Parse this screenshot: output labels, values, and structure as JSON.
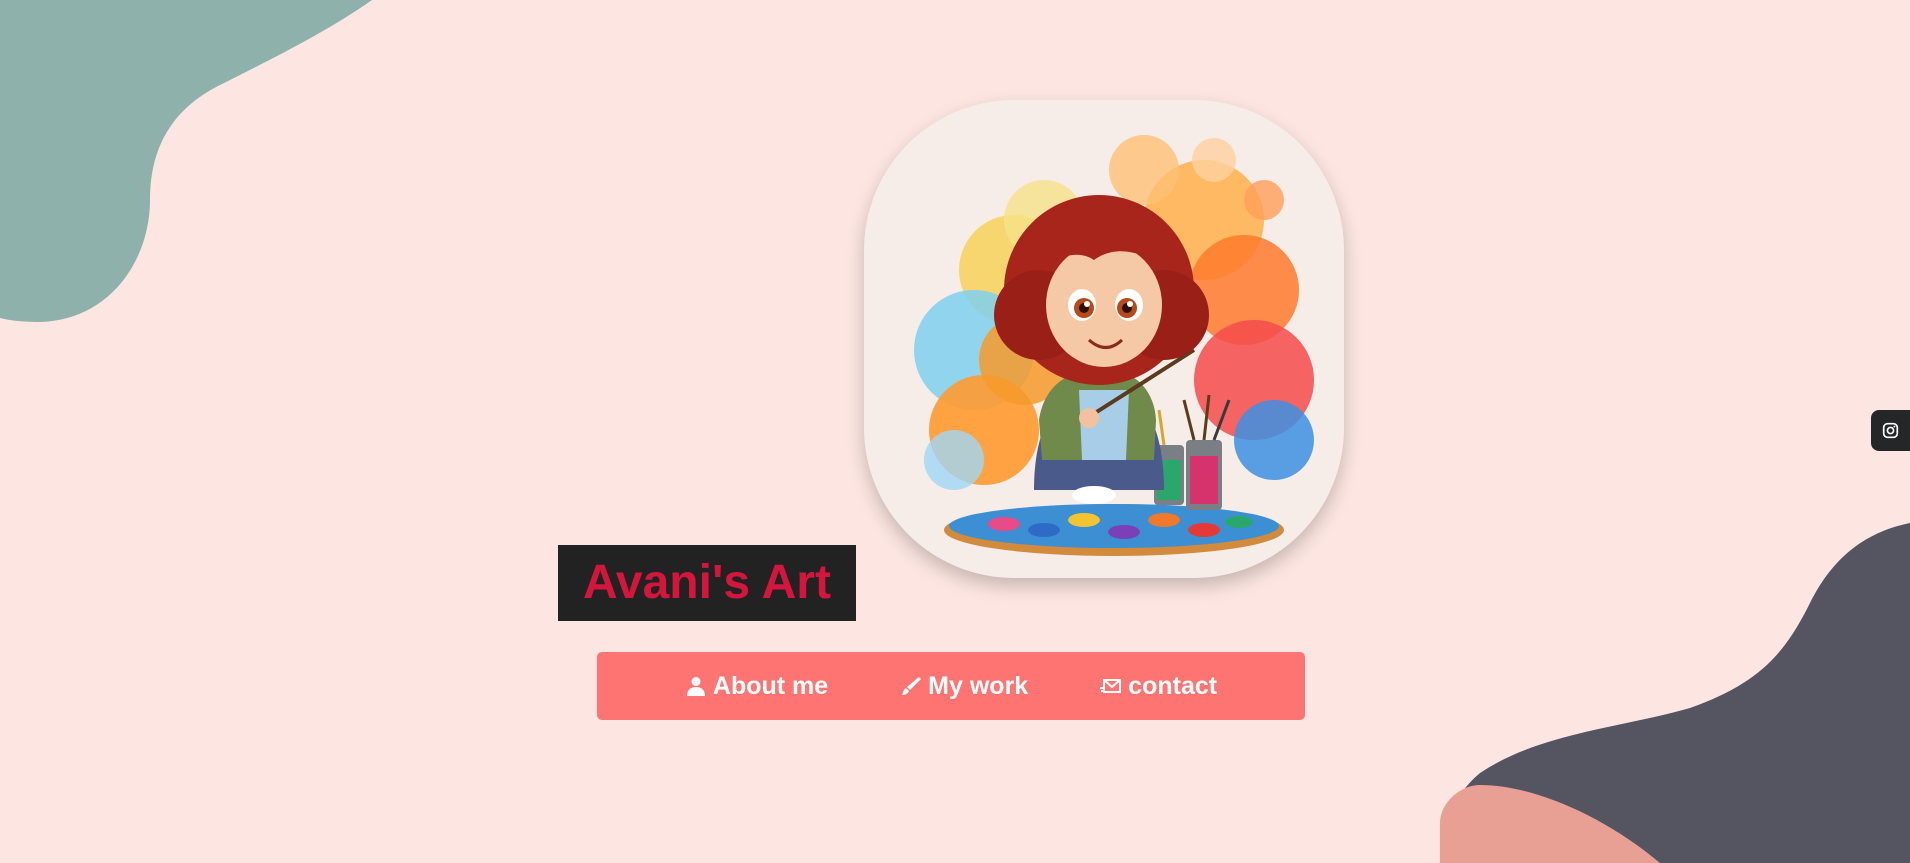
{
  "site": {
    "title": "Avani's Art"
  },
  "nav": {
    "items": [
      {
        "label": "About me",
        "icon": "user-icon"
      },
      {
        "label": "My work",
        "icon": "brush-icon"
      },
      {
        "label": "contact",
        "icon": "mail-icon"
      }
    ]
  },
  "social": {
    "icon": "instagram-icon"
  },
  "avatar": {
    "description_icon": "artist-girl-illustration"
  },
  "colors": {
    "background": "#fde6e1",
    "title_bg": "#222222",
    "title_text": "#d4163d",
    "nav_bg": "#fd7472",
    "nav_text": "#ffffff",
    "blob_teal": "#8fb1ac",
    "blob_dark": "#555461",
    "blob_pink": "#e8a095",
    "social_bg": "#252628"
  }
}
